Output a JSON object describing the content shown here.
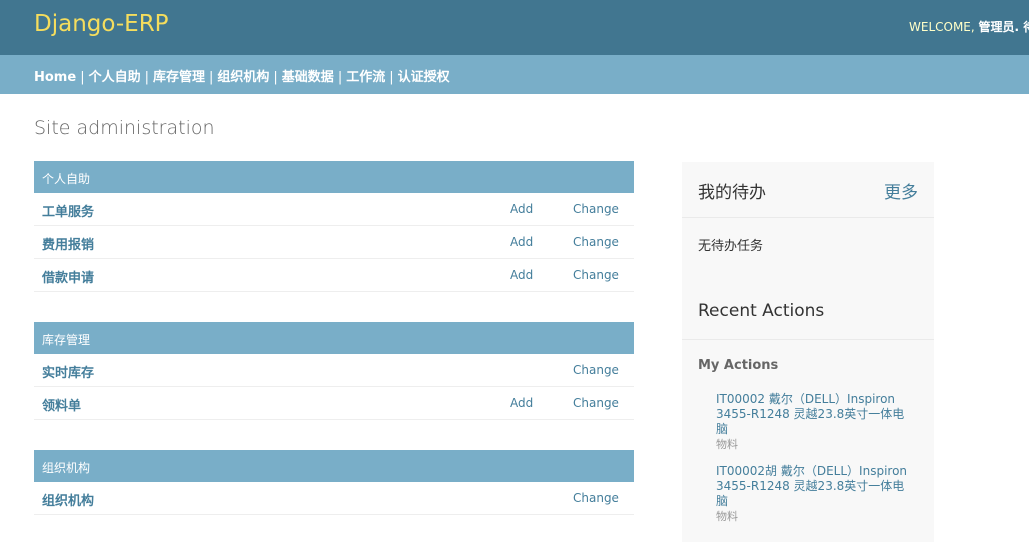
{
  "header": {
    "brand": "Django-ERP",
    "welcome": "WELCOME,",
    "user": "管理员. 待"
  },
  "nav": {
    "items": [
      "Home",
      "个人自助",
      "库存管理",
      "组织机构",
      "基础数据",
      "工作流",
      "认证授权"
    ],
    "separator": "|"
  },
  "page_title": "Site administration",
  "modules": [
    {
      "caption": "个人自助",
      "rows": [
        {
          "label": "工单服务",
          "add": "Add",
          "change": "Change"
        },
        {
          "label": "费用报销",
          "add": "Add",
          "change": "Change"
        },
        {
          "label": "借款申请",
          "add": "Add",
          "change": "Change"
        }
      ]
    },
    {
      "caption": "库存管理",
      "rows": [
        {
          "label": "实时库存",
          "add": "",
          "change": "Change"
        },
        {
          "label": "领料单",
          "add": "Add",
          "change": "Change"
        }
      ]
    },
    {
      "caption": "组织机构",
      "rows": [
        {
          "label": "组织机构",
          "add": "",
          "change": "Change"
        }
      ]
    }
  ],
  "sidebar": {
    "todo_title": "我的待办",
    "todo_more": "更多",
    "todo_empty": "无待办任务",
    "recent_title": "Recent Actions",
    "my_actions": "My Actions",
    "actions": [
      {
        "line1": "IT00002 戴尔（DELL）Inspiron",
        "line2": "3455-R1248 灵越23.8英寸一体电",
        "line3": "脑",
        "type": "物料"
      },
      {
        "line1": "IT00002胡 戴尔（DELL）Inspiron",
        "line2": "3455-R1248 灵越23.8英寸一体电",
        "line3": "脑",
        "type": "物料"
      }
    ]
  },
  "colors": {
    "header_bg": "#417690",
    "nav_bg": "#79aec8",
    "brand": "#f5dd5d",
    "link": "#447e9b"
  }
}
